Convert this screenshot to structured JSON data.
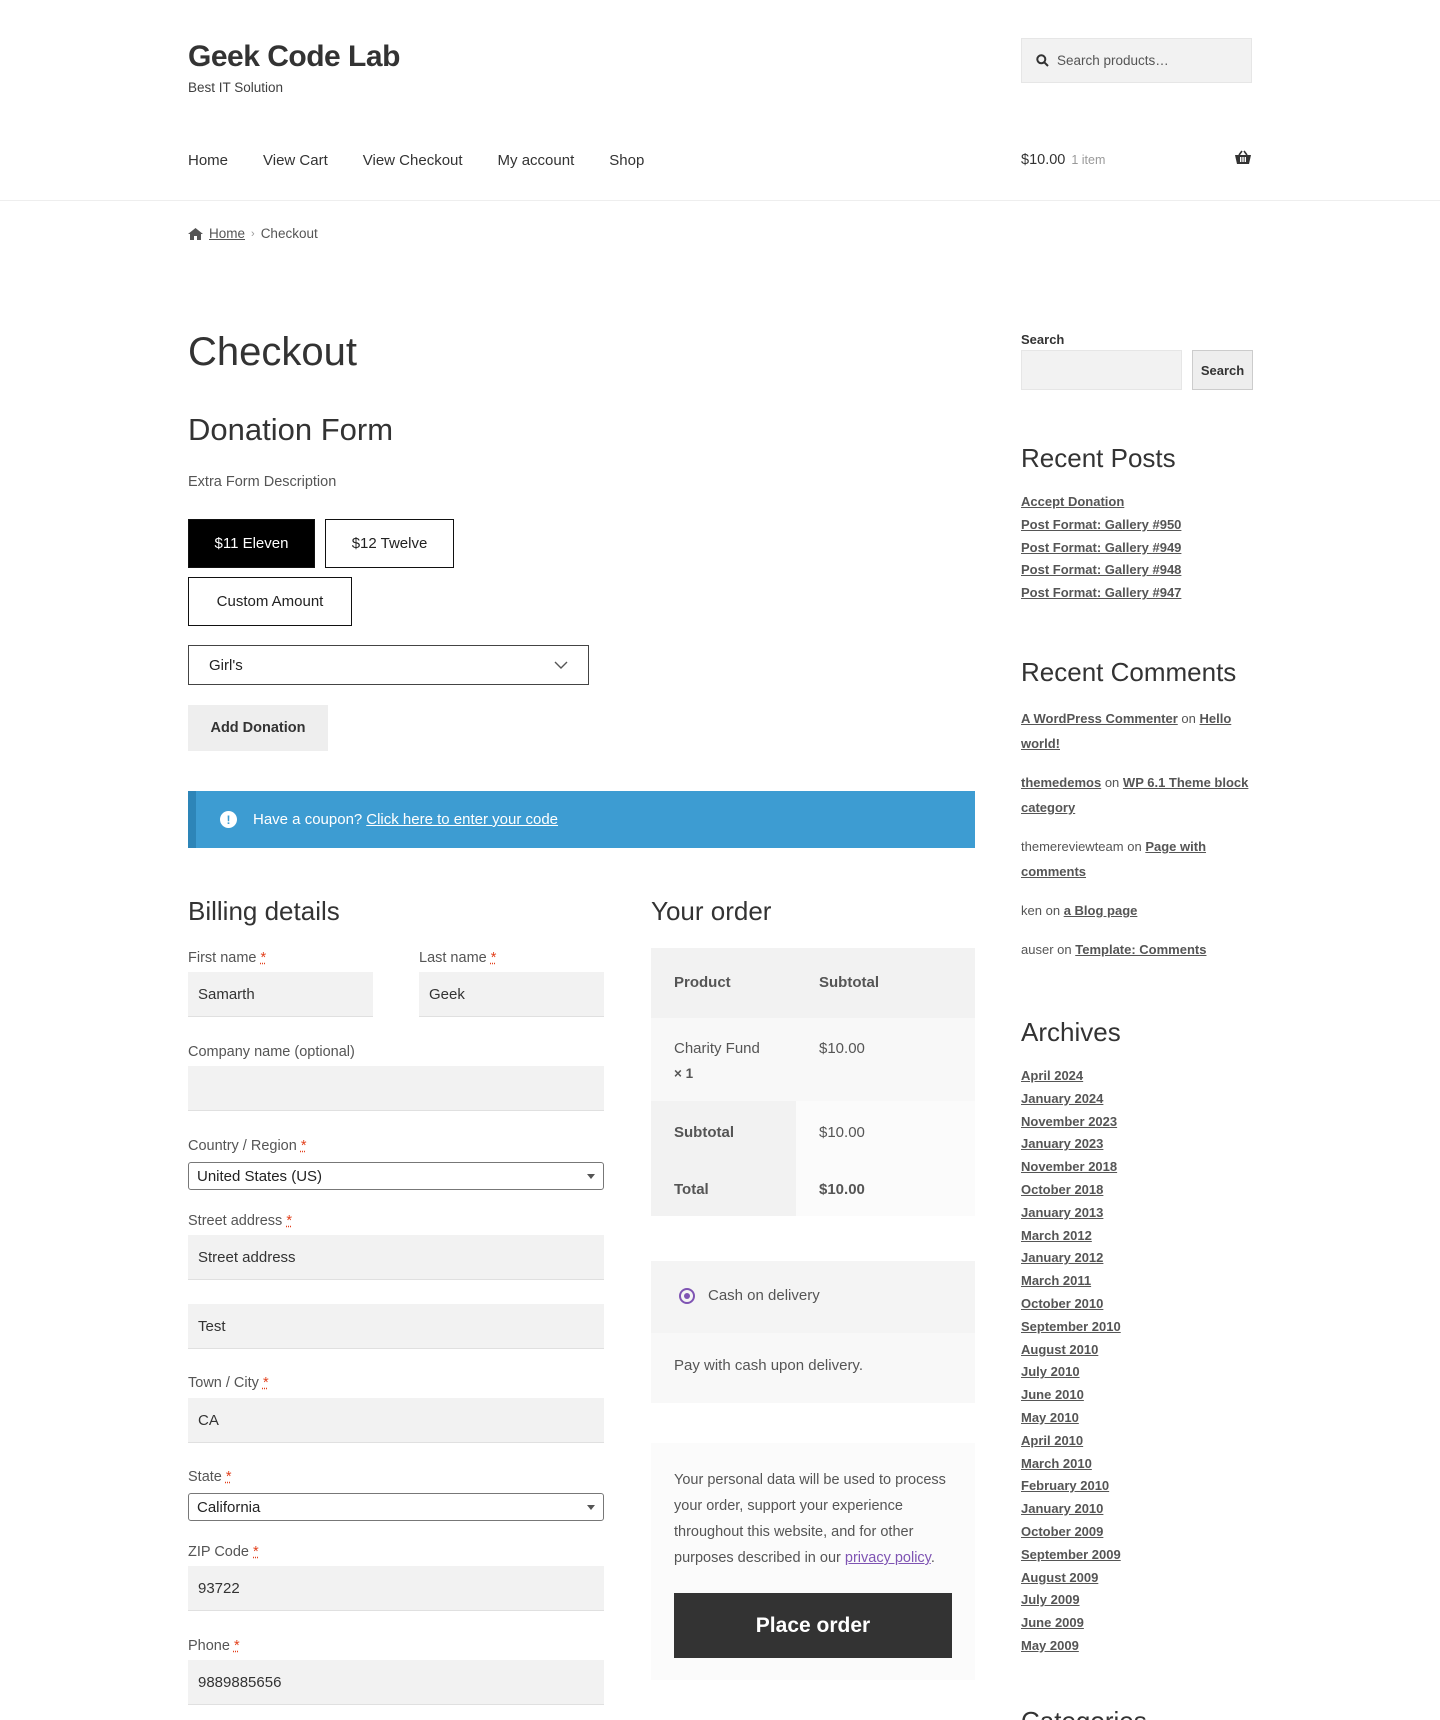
{
  "site": {
    "title": "Geek Code Lab",
    "tagline": "Best IT Solution"
  },
  "header": {
    "search_placeholder": "Search products…",
    "nav": [
      "Home",
      "View Cart",
      "View Checkout",
      "My account",
      "Shop"
    ],
    "cart_total": "$10.00",
    "cart_count": "1 item"
  },
  "breadcrumb": {
    "home": "Home",
    "current": "Checkout"
  },
  "page": {
    "title": "Checkout"
  },
  "donation": {
    "title": "Donation Form",
    "description": "Extra Form Description",
    "amounts": [
      "$11 Eleven",
      "$12 Twelve",
      "Custom Amount"
    ],
    "selected_amount": "$11 Eleven",
    "dropdown_value": "Girl's",
    "add_button": "Add Donation"
  },
  "coupon": {
    "text": "Have a coupon?",
    "link": "Click here to enter your code"
  },
  "billing": {
    "title": "Billing details",
    "req_mark": "*",
    "first_name_label": "First name",
    "first_name": "Samarth",
    "last_name_label": "Last name",
    "last_name": "Geek",
    "company_label": "Company name (optional)",
    "company": "",
    "country_label": "Country / Region",
    "country": "United States (US)",
    "street_label": "Street address",
    "street1_placeholder": "Street address",
    "street2": "Test",
    "city_label": "Town / City",
    "city": "CA",
    "state_label": "State",
    "state": "California",
    "zip_label": "ZIP Code",
    "zip": "93722",
    "phone_label": "Phone",
    "phone": "9889885656"
  },
  "order": {
    "title": "Your order",
    "col_product": "Product",
    "col_subtotal": "Subtotal",
    "item_name": "Charity Fund",
    "item_qty": "× 1",
    "item_price": "$10.00",
    "subtotal_label": "Subtotal",
    "subtotal": "$10.00",
    "total_label": "Total",
    "total": "$10.00"
  },
  "payment": {
    "method": "Cash on delivery",
    "description": "Pay with cash upon delivery."
  },
  "privacy": {
    "text": "Your personal data will be used to process your order, support your experience throughout this website, and for other purposes described in our",
    "link": "privacy policy",
    "end": ".",
    "place_order": "Place order"
  },
  "sidebar": {
    "search_label": "Search",
    "search_button": "Search",
    "recent_posts_title": "Recent Posts",
    "recent_posts": [
      "Accept Donation",
      "Post Format: Gallery #950",
      "Post Format: Gallery #949",
      "Post Format: Gallery #948",
      "Post Format: Gallery #947"
    ],
    "recent_comments_title": "Recent Comments",
    "on": "on",
    "comments": [
      {
        "author": "A WordPress Commenter",
        "post": "Hello world!"
      },
      {
        "author": "themedemos",
        "post": "WP 6.1 Theme block category"
      },
      {
        "author": "themereviewteam",
        "post": "Page with comments"
      },
      {
        "author": "ken",
        "post": "a Blog page"
      },
      {
        "author": "auser",
        "post": "Template: Comments"
      }
    ],
    "archives_title": "Archives",
    "archives": [
      "April 2024",
      "January 2024",
      "November 2023",
      "January 2023",
      "November 2018",
      "October 2018",
      "January 2013",
      "March 2012",
      "January 2012",
      "March 2011",
      "October 2010",
      "September 2010",
      "August 2010",
      "July 2010",
      "June 2010",
      "May 2010",
      "April 2010",
      "March 2010",
      "February 2010",
      "January 2010",
      "October 2009",
      "September 2009",
      "August 2009",
      "July 2009",
      "June 2009",
      "May 2009"
    ],
    "categories_title": "Categories"
  }
}
